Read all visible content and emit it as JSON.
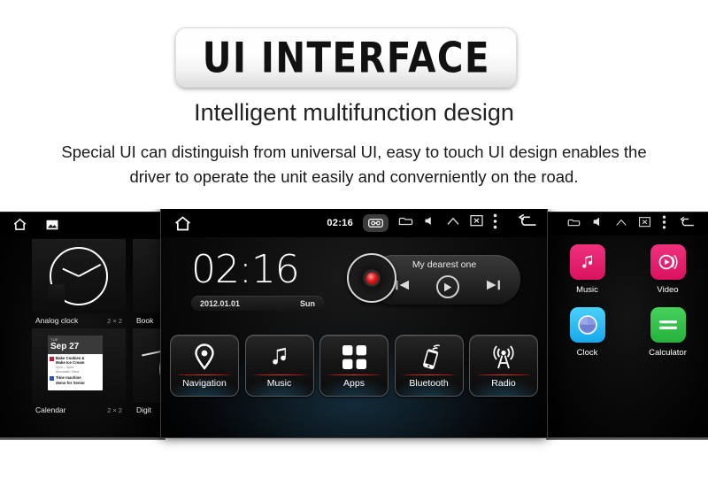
{
  "header": {
    "banner_title": "UI INTERFACE",
    "subtitle": "Intelligent multifunction design",
    "paragraph_line1": "Special UI can distinguish from universal UI, easy to touch UI design enables the",
    "paragraph_line2": "driver to operate the unit easily and converniently on the road."
  },
  "colors": {
    "accent_red": "#cf1f1f",
    "music_pink": "#e8186e",
    "video_pink": "#e8186e",
    "clock_blue": "#2bb7f0",
    "calculator_green": "#34c24c",
    "screen_black": "#000000",
    "text_white": "#ffffff"
  },
  "left_screen": {
    "name": "widget-picker",
    "statusbar_icons": [
      "home-icon",
      "wallpaper-icon"
    ],
    "widgets": [
      {
        "label": "Analog clock",
        "size": "2 × 2"
      },
      {
        "label": "Calendar",
        "size": "2 × 2"
      },
      {
        "label": "Book",
        "size": ""
      },
      {
        "label": "Digit",
        "size": ""
      }
    ],
    "calendar_widget": {
      "day_of_week": "TUE",
      "date": "Sep 27",
      "events": [
        {
          "title": "Bake Cookies &",
          "title2": "Make Ice Cream",
          "time": "2pm – 3pm",
          "place": "Mountain View",
          "color": "#b3253a"
        },
        {
          "title": "Time machine",
          "title2": "demo for Senior",
          "time": "",
          "place": "",
          "color": "#2c4fb0"
        }
      ]
    }
  },
  "center_screen": {
    "name": "car-head-unit-home",
    "statusbar": {
      "home_icon": "home-icon",
      "time": "02:16",
      "icons": [
        "radio-cassette-icon",
        "sd-card-icon",
        "volume-icon",
        "eject-icon",
        "screen-off-icon",
        "overflow-menu-icon",
        "back-icon"
      ],
      "highlighted_icon": "radio-cassette-icon"
    },
    "clock": {
      "time": "02:16",
      "date": "2012.01.01",
      "day_of_week": "Sun"
    },
    "media": {
      "track_title": "My dearest one",
      "prev_label": "prev-track-button",
      "play_label": "play-button",
      "next_label": "next-track-button"
    },
    "apps": [
      {
        "label": "Navigation",
        "icon": "map-pin-icon"
      },
      {
        "label": "Music",
        "icon": "music-note-icon"
      },
      {
        "label": "Apps",
        "icon": "grid-apps-icon"
      },
      {
        "label": "Bluetooth",
        "icon": "phone-link-icon"
      },
      {
        "label": "Radio",
        "icon": "radio-tower-icon"
      }
    ]
  },
  "right_screen": {
    "name": "app-drawer",
    "statusbar_icons": [
      "sd-card-icon",
      "volume-icon",
      "eject-icon",
      "screen-off-icon",
      "overflow-menu-icon",
      "back-icon"
    ],
    "apps": [
      {
        "label": "Music",
        "icon": "music-note-icon",
        "color": "#e8186e"
      },
      {
        "label": "Video",
        "icon": "video-play-icon",
        "color": "#e8186e"
      },
      {
        "label": "Clock",
        "icon": "clock-sphere-icon",
        "color": "#2bb7f0"
      },
      {
        "label": "Calculator",
        "icon": "equals-icon",
        "color": "#34c24c"
      }
    ]
  }
}
